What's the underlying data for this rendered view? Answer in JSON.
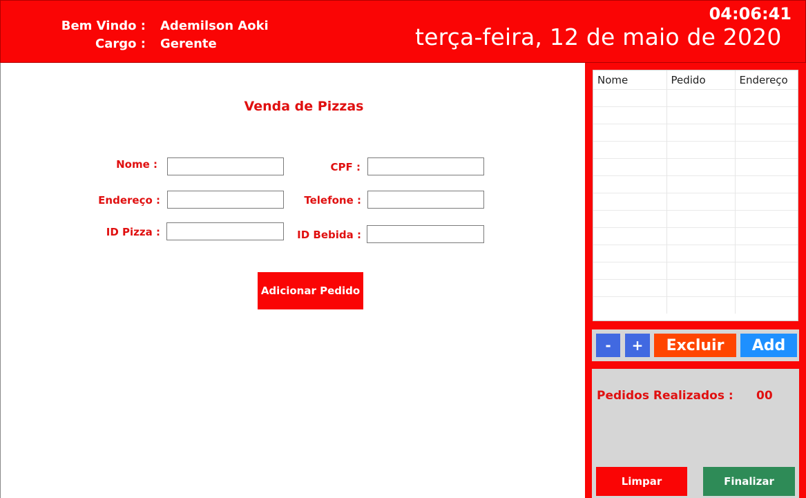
{
  "header": {
    "welcome_label": "Bem Vindo :",
    "welcome_value": "Ademilson Aoki",
    "role_label": "Cargo :",
    "role_value": "Gerente",
    "clock": "04:06:41",
    "date": "terça-feira, 12 de maio de 2020"
  },
  "form": {
    "title": "Venda de Pizzas",
    "name_label": "Nome :",
    "name_value": "",
    "cpf_label": "CPF :",
    "cpf_value": "",
    "address_label": "Endereço :",
    "address_value": "",
    "phone_label": "Telefone :",
    "phone_value": "",
    "pizza_id_label": "ID Pizza :",
    "pizza_id_value": "",
    "drink_id_label": "ID Bebida :",
    "drink_id_value": "",
    "add_order_label": "Adicionar Pedido"
  },
  "orders_grid": {
    "columns": [
      "Nome",
      "Pedido",
      "Endereço"
    ],
    "rows": []
  },
  "actions": {
    "minus_label": "-",
    "plus_label": "+",
    "delete_label": "Excluir",
    "add_label": "Add"
  },
  "summary": {
    "orders_label": "Pedidos Realizados :",
    "orders_count": "00",
    "clear_label": "Limpar",
    "finish_label": "Finalizar"
  },
  "colors": {
    "brand_red": "#fa0505",
    "panel_gray": "#d6d6d6",
    "minus_plus_blue": "#4169e1",
    "delete_orange": "#ff4500",
    "add_blue": "#1e90ff",
    "finish_green": "#2e8b57"
  }
}
